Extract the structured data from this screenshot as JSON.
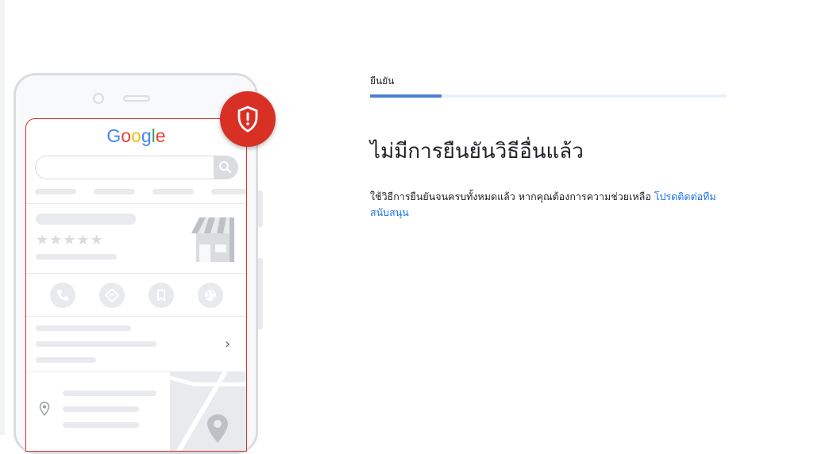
{
  "illustration": {
    "logo_text": "Google",
    "logo_colors": [
      "#4285F4",
      "#EA4335",
      "#FBBC05",
      "#4285F4",
      "#34A853",
      "#EA4335"
    ],
    "rating_stars": "★★★★★",
    "chevron": "›",
    "shield_color": "#d93025",
    "icons": [
      "search-icon",
      "phone-icon",
      "directions-icon",
      "bookmark-icon",
      "globe-icon",
      "map-pin-icon",
      "store-icon",
      "shield-alert-icon"
    ]
  },
  "step": {
    "label": "ยืนยัน",
    "progress": 0.2
  },
  "main": {
    "title": "ไม่มีการยืนยันวิธีอื่นแล้ว",
    "description": "ใช้วิธีการยืนยันจนครบทั้งหมดแล้ว หากคุณต้องการความช่วยเหลือ ",
    "support_link": "โปรดติดต่อทีมสนับสนุน"
  }
}
